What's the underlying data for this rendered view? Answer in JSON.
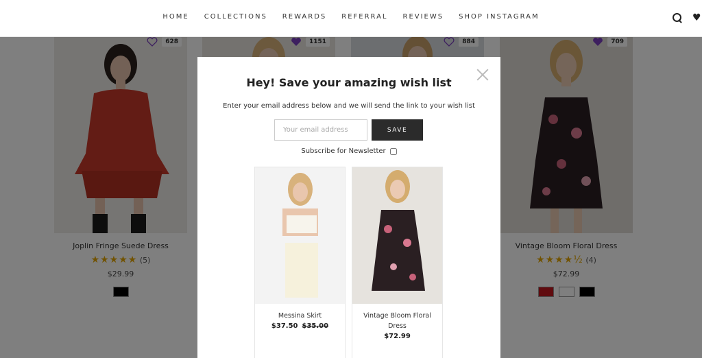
{
  "nav": {
    "items": [
      "HOME",
      "COLLECTIONS",
      "REWARDS",
      "REFERRAL",
      "REVIEWS",
      "SHOP INSTAGRAM"
    ],
    "icons": [
      "search-icon",
      "heart-icon"
    ]
  },
  "products": [
    {
      "title": "Joplin Fringe Suede Dress",
      "rating_stars": "★★★★★",
      "review_count": "(5)",
      "price": "$29.99",
      "wish_count": "628",
      "swatches": [
        "#000000"
      ]
    },
    {
      "title": "",
      "wish_count": "1151"
    },
    {
      "title": "",
      "wish_count": "884"
    },
    {
      "title": "Vintage Bloom Floral Dress",
      "rating_stars": "★★★★½",
      "review_count": "(4)",
      "price": "$72.99",
      "wish_count": "709",
      "swatches": [
        "#c0171e",
        "#ffffff",
        "#000000"
      ]
    }
  ],
  "modal": {
    "title": "Hey! Save your amazing wish list",
    "subtitle": "Enter your email address below and we will send the link to your wish list",
    "email_placeholder": "Your email address",
    "save_label": "SAVE",
    "newsletter_label": "Subscribe for Newsletter",
    "newsletter_checked": false,
    "items": [
      {
        "name": "Messina Skirt",
        "price": "$37.50",
        "old_price": "$35.00"
      },
      {
        "name": "Vintage Bloom Floral Dress",
        "price": "$72.99",
        "old_price": ""
      }
    ]
  },
  "colors": {
    "accent_purple": "#7b3fbf",
    "star_gold": "#e2a500",
    "button_dark": "#2b2b2b"
  }
}
